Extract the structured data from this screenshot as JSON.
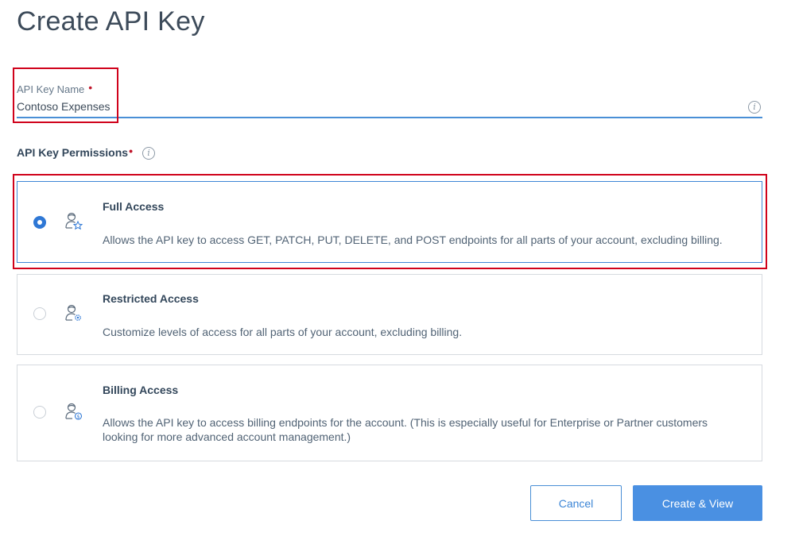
{
  "page": {
    "title": "Create API Key"
  },
  "name_field": {
    "label": "API Key Name",
    "required_marker": "•",
    "value": "Contoso Expenses",
    "info_icon": "info-icon"
  },
  "permissions": {
    "label": "API Key Permissions",
    "required_marker": "•",
    "info_icon": "info-icon",
    "options": [
      {
        "title": "Full Access",
        "description": "Allows the API key to access GET, PATCH, PUT, DELETE, and POST endpoints for all parts of your account, excluding billing.",
        "icon": "user-star-icon",
        "selected": true
      },
      {
        "title": "Restricted Access",
        "description": "Customize levels of access for all parts of your account, excluding billing.",
        "icon": "user-gear-icon",
        "selected": false
      },
      {
        "title": "Billing Access",
        "description": "Allows the API key to access billing endpoints for the account. (This is especially useful for Enterprise or Partner customers looking for more advanced account management.)",
        "icon": "user-dollar-icon",
        "selected": false
      }
    ]
  },
  "actions": {
    "cancel_label": "Cancel",
    "create_label": "Create & View"
  },
  "colors": {
    "accent": "#4a90e2",
    "highlight": "#d0021b",
    "required": "#c0162b"
  }
}
